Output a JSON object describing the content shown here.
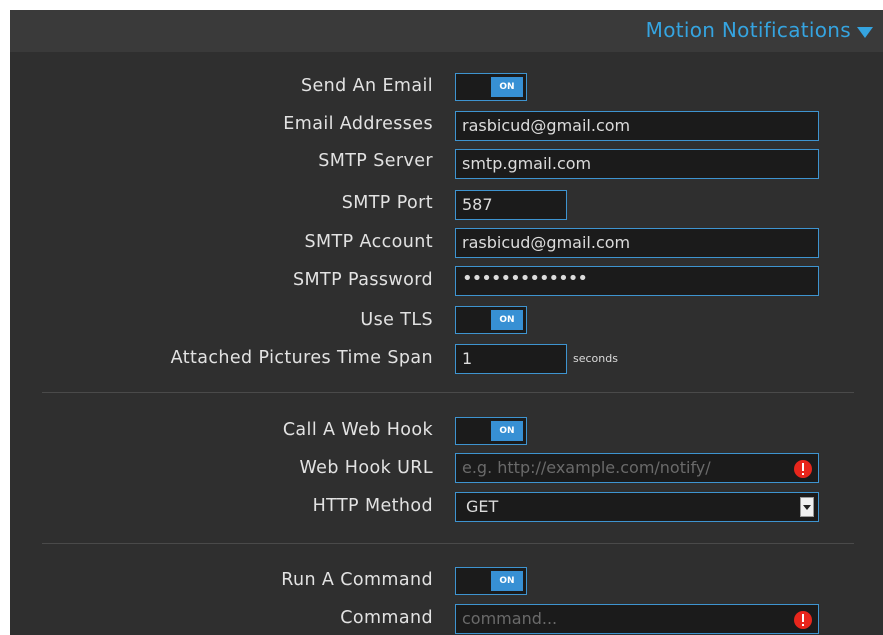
{
  "header": {
    "title": "Motion Notifications"
  },
  "email": {
    "send_label": "Send An Email",
    "send_toggle": "ON",
    "addresses_label": "Email Addresses",
    "addresses_value": "rasbicud@gmail.com",
    "smtp_server_label": "SMTP Server",
    "smtp_server_value": "smtp.gmail.com",
    "smtp_port_label": "SMTP Port",
    "smtp_port_value": "587",
    "smtp_account_label": "SMTP Account",
    "smtp_account_value": "rasbicud@gmail.com",
    "smtp_password_label": "SMTP Password",
    "smtp_password_value": "•••••••••••••",
    "tls_label": "Use TLS",
    "tls_toggle": "ON",
    "time_span_label": "Attached Pictures Time Span",
    "time_span_value": "1",
    "time_span_unit": "seconds"
  },
  "webhook": {
    "call_label": "Call A Web Hook",
    "call_toggle": "ON",
    "url_label": "Web Hook URL",
    "url_placeholder": "e.g. http://example.com/notify/",
    "method_label": "HTTP Method",
    "method_value": "GET"
  },
  "command": {
    "run_label": "Run A Command",
    "run_toggle": "ON",
    "command_label": "Command",
    "command_placeholder": "command..."
  },
  "colors": {
    "accent": "#3790d4",
    "header_text": "#35a4e0",
    "panel_bg": "#2f2f2f",
    "error": "#e8261c"
  }
}
